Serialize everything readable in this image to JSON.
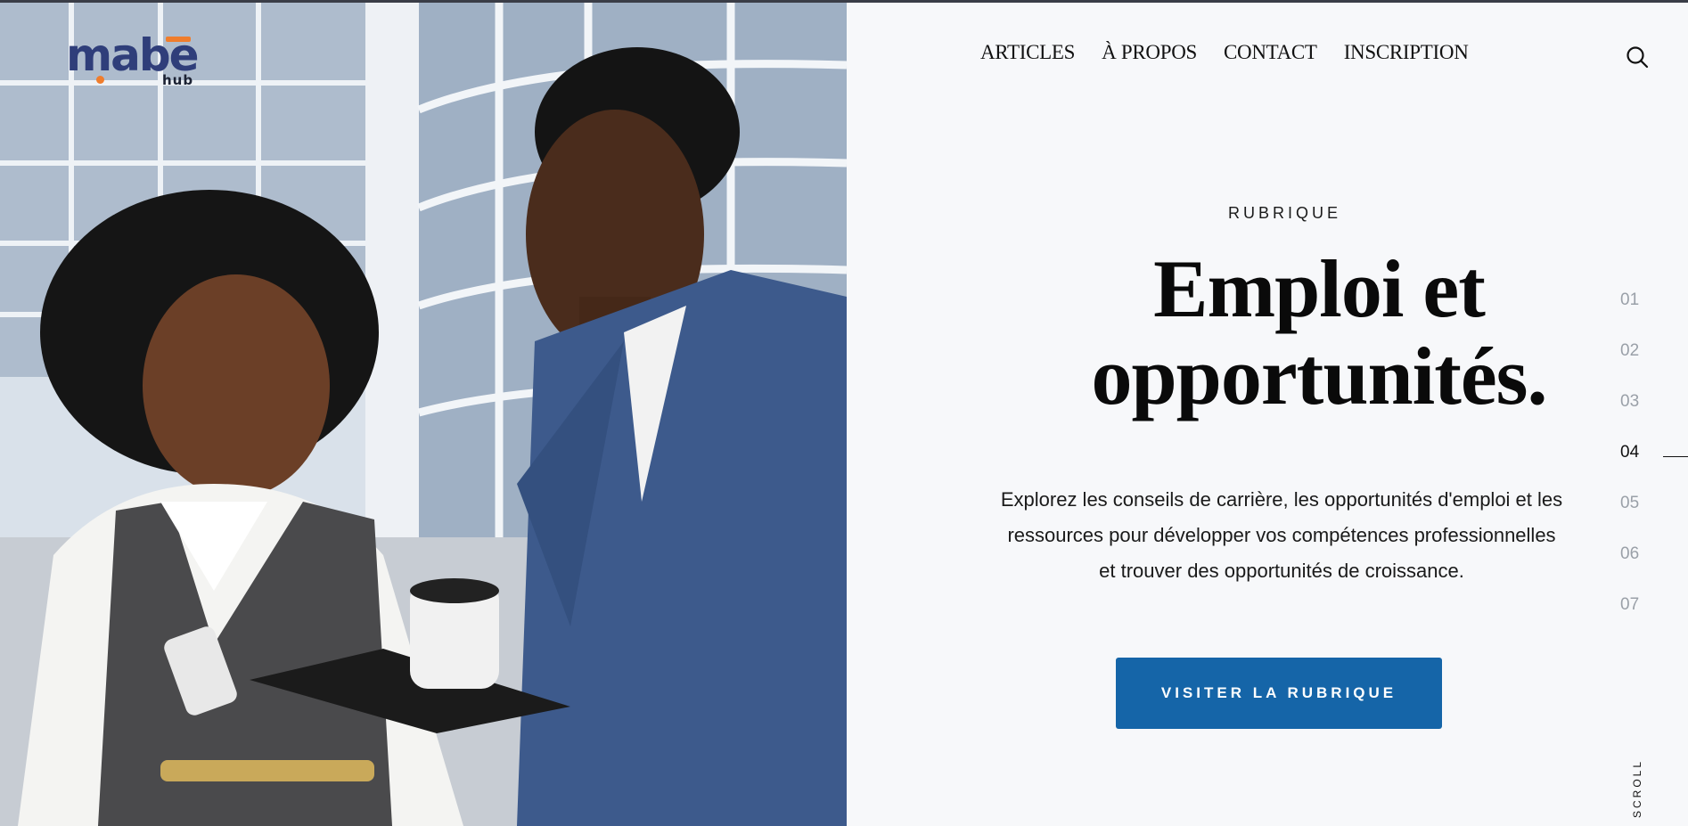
{
  "brand": {
    "logo_text": "mabe",
    "logo_sub": "hub",
    "accent": "#f07d2c",
    "primary": "#2f3e7a"
  },
  "nav": {
    "items": [
      {
        "label": "ARTICLES"
      },
      {
        "label": "À PROPOS"
      },
      {
        "label": "CONTACT"
      },
      {
        "label": "INSCRIPTION"
      }
    ],
    "search_icon": "search-icon"
  },
  "hero": {
    "eyebrow": "RUBRIQUE",
    "headline_line1": "Emploi et",
    "headline_line2": "opportunités.",
    "description": "Explorez les conseils de carrière, les opportunités d'emploi et les ressources pour développer vos compétences professionnelles et trouver des opportunités de croissance.",
    "cta_label": "VISITER LA RUBRIQUE",
    "cta_color": "#1565a8"
  },
  "slides": {
    "items": [
      "01",
      "02",
      "03",
      "04",
      "05",
      "06",
      "07"
    ],
    "active": "04"
  },
  "scroll_label": "SCROLL"
}
